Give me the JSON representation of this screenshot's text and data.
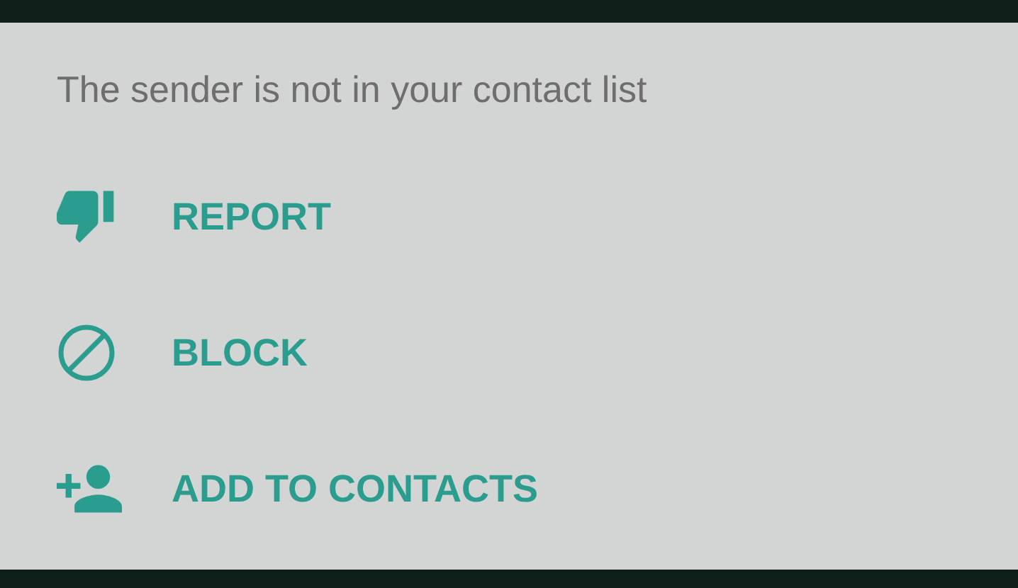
{
  "notice": "The sender is not in your contact list",
  "actions": [
    {
      "kind": "report",
      "label": "REPORT"
    },
    {
      "kind": "block",
      "label": "BLOCK"
    },
    {
      "kind": "add-contact",
      "label": "ADD TO CONTACTS"
    }
  ]
}
